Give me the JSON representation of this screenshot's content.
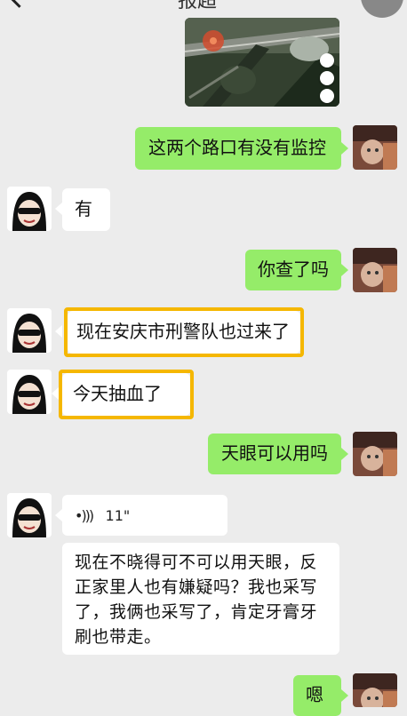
{
  "header": {
    "title": "报超"
  },
  "messages": {
    "m1": "这两个路口有没有监控",
    "m2": "有",
    "m3": "你查了吗",
    "m4": "现在安庆市刑警队也过来了",
    "m5": "今天抽血了",
    "m6": "天眼可以用吗",
    "m7_voice": "11\"",
    "m8": "现在不晓得可不可以用天眼，反正家里人也有嫌疑吗？我也采写了，我俩也采写了，肯定牙膏牙刷也带走。",
    "m9": "嗯"
  },
  "colors": {
    "outgoing_bubble": "#95ec69",
    "incoming_bubble": "#ffffff",
    "highlight_frame": "#f5b700",
    "background": "#ececec"
  },
  "icons": {
    "back": "chevron-left-icon",
    "voice": "voice-wave-icon"
  }
}
